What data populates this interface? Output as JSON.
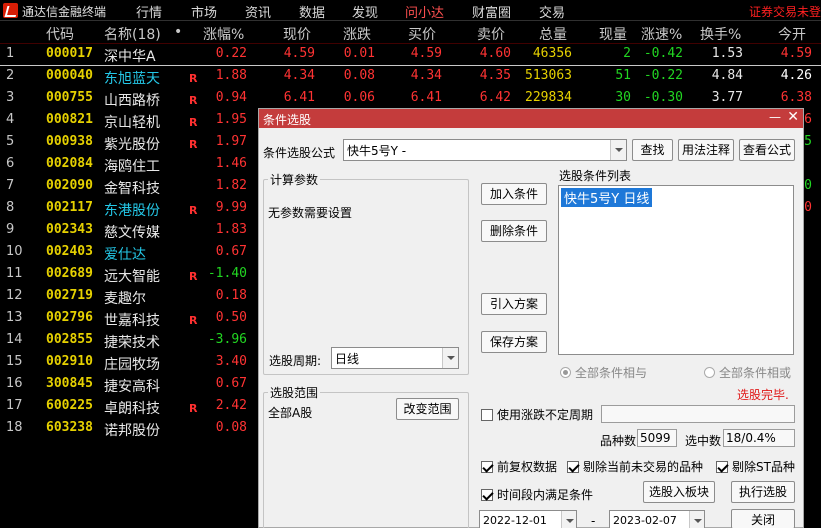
{
  "app": {
    "title": "通达信金融终端",
    "menu": [
      "行情",
      "市场",
      "资讯",
      "数据",
      "发现",
      "问小达",
      "财富圈",
      "交易"
    ],
    "active_menu": 5,
    "trade_notice": "证券交易未登"
  },
  "table": {
    "headers": {
      "code": "代码",
      "name": "名称(18)",
      "dot": "•",
      "pct": "涨幅%",
      "price": "现价",
      "chg": "涨跌",
      "bid": "买价",
      "ask": "卖价",
      "vol": "总量",
      "cur": "现量",
      "speed": "涨速%",
      "turn": "换手%",
      "open": "今开"
    },
    "rows": [
      {
        "idx": "1",
        "code": "000017",
        "name": "深中华A",
        "name_color": "white",
        "r": "",
        "pct": "0.22",
        "price": "4.59",
        "chg": "0.01",
        "bid": "4.59",
        "ask": "4.60",
        "vol": "46356",
        "cur": "2",
        "speed": "-0.42",
        "turn": "1.53",
        "open": "4.59",
        "open_color": "red"
      },
      {
        "idx": "2",
        "code": "000040",
        "name": "东旭蓝天",
        "name_color": "cyan",
        "r": "R",
        "pct": "1.88",
        "price": "4.34",
        "chg": "0.08",
        "bid": "4.34",
        "ask": "4.35",
        "vol": "513063",
        "cur": "51",
        "speed": "-0.22",
        "turn": "4.84",
        "open": "4.26",
        "open_color": "white"
      },
      {
        "idx": "3",
        "code": "000755",
        "name": "山西路桥",
        "name_color": "white",
        "r": "R",
        "pct": "0.94",
        "price": "6.41",
        "chg": "0.06",
        "bid": "6.41",
        "ask": "6.42",
        "vol": "229834",
        "cur": "30",
        "speed": "-0.30",
        "turn": "3.77",
        "open": "6.38",
        "open_color": "red"
      },
      {
        "idx": "4",
        "code": "000821",
        "name": "京山轻机",
        "name_color": "white",
        "r": "R",
        "pct": "1.95",
        "price": "",
        "chg": "",
        "bid": "",
        "ask": "",
        "vol": "",
        "cur": "",
        "speed": "",
        "turn": "",
        "open": "6",
        "open_color": "red"
      },
      {
        "idx": "5",
        "code": "000938",
        "name": "紫光股份",
        "name_color": "white",
        "r": "R",
        "pct": "1.97",
        "price": "",
        "chg": "",
        "bid": "",
        "ask": "",
        "vol": "",
        "cur": "",
        "speed": "",
        "turn": "",
        "open": "5",
        "open_color": "green"
      },
      {
        "idx": "6",
        "code": "002084",
        "name": "海鸥住工",
        "name_color": "white",
        "r": "",
        "pct": "1.46",
        "price": "",
        "chg": "",
        "bid": "",
        "ask": "",
        "vol": "",
        "cur": "",
        "speed": "",
        "turn": "",
        "open": "",
        "open_color": "red"
      },
      {
        "idx": "7",
        "code": "002090",
        "name": "金智科技",
        "name_color": "white",
        "r": "",
        "pct": "1.82",
        "price": "",
        "chg": "",
        "bid": "",
        "ask": "",
        "vol": "",
        "cur": "",
        "speed": "",
        "turn": "",
        "open": "0",
        "open_color": "green"
      },
      {
        "idx": "8",
        "code": "002117",
        "name": "东港股份",
        "name_color": "cyan",
        "r": "R",
        "pct": "9.99",
        "price": "",
        "chg": "",
        "bid": "",
        "ask": "",
        "vol": "",
        "cur": "",
        "speed": "",
        "turn": "",
        "open": "0",
        "open_color": "red"
      },
      {
        "idx": "9",
        "code": "002343",
        "name": "慈文传媒",
        "name_color": "white",
        "r": "",
        "pct": "1.83",
        "price": "",
        "chg": "",
        "bid": "",
        "ask": "",
        "vol": "",
        "cur": "",
        "speed": "",
        "turn": "",
        "open": "",
        "open_color": "red"
      },
      {
        "idx": "10",
        "code": "002403",
        "name": "爱仕达",
        "name_color": "cyan",
        "r": "",
        "pct": "0.67",
        "price": "",
        "chg": "",
        "bid": "",
        "ask": "",
        "vol": "",
        "cur": "",
        "speed": "",
        "turn": "",
        "open": "",
        "open_color": "red"
      },
      {
        "idx": "11",
        "code": "002689",
        "name": "远大智能",
        "name_color": "white",
        "r": "R",
        "pct": "-1.40",
        "price": "",
        "chg": "",
        "bid": "",
        "ask": "",
        "vol": "",
        "cur": "",
        "speed": "",
        "turn": "",
        "open": "",
        "open_color": "red"
      },
      {
        "idx": "12",
        "code": "002719",
        "name": "麦趣尔",
        "name_color": "white",
        "r": "",
        "pct": "0.18",
        "price": "",
        "chg": "",
        "bid": "",
        "ask": "",
        "vol": "",
        "cur": "",
        "speed": "",
        "turn": "",
        "open": "",
        "open_color": "red"
      },
      {
        "idx": "13",
        "code": "002796",
        "name": "世嘉科技",
        "name_color": "white",
        "r": "R",
        "pct": "0.50",
        "price": "",
        "chg": "",
        "bid": "",
        "ask": "",
        "vol": "",
        "cur": "",
        "speed": "",
        "turn": "",
        "open": "",
        "open_color": "red"
      },
      {
        "idx": "14",
        "code": "002855",
        "name": "捷荣技术",
        "name_color": "white",
        "r": "",
        "pct": "-3.96",
        "price": "",
        "chg": "",
        "bid": "",
        "ask": "",
        "vol": "",
        "cur": "",
        "speed": "",
        "turn": "",
        "open": "",
        "open_color": "red"
      },
      {
        "idx": "15",
        "code": "002910",
        "name": "庄园牧场",
        "name_color": "white",
        "r": "",
        "pct": "3.40",
        "price": "",
        "chg": "",
        "bid": "",
        "ask": "",
        "vol": "",
        "cur": "",
        "speed": "",
        "turn": "",
        "open": "",
        "open_color": "red"
      },
      {
        "idx": "16",
        "code": "300845",
        "name": "捷安高科",
        "name_color": "white",
        "r": "",
        "pct": "0.67",
        "price": "",
        "chg": "",
        "bid": "",
        "ask": "",
        "vol": "",
        "cur": "",
        "speed": "",
        "turn": "",
        "open": "",
        "open_color": "red"
      },
      {
        "idx": "17",
        "code": "600225",
        "name": "卓朗科技",
        "name_color": "white",
        "r": "R",
        "pct": "2.42",
        "price": "",
        "chg": "",
        "bid": "",
        "ask": "",
        "vol": "",
        "cur": "",
        "speed": "",
        "turn": "",
        "open": "",
        "open_color": "red"
      },
      {
        "idx": "18",
        "code": "603238",
        "name": "诺邦股份",
        "name_color": "white",
        "r": "",
        "pct": "0.08",
        "price": "",
        "chg": "",
        "bid": "",
        "ask": "",
        "vol": "",
        "cur": "",
        "speed": "",
        "turn": "",
        "open": "",
        "open_color": "red"
      }
    ]
  },
  "dialog": {
    "title": "条件选股",
    "min_glyph": "—",
    "close_glyph": "✕",
    "formula_label": "条件选股公式",
    "formula_value": "快牛5号Y    -",
    "find_btn": "查找",
    "usage_btn": "用法注释",
    "view_formula_btn": "查看公式",
    "params_group": "计算参数",
    "params_text": "无参数需要设置",
    "add_cond_btn": "加入条件",
    "del_cond_btn": "删除条件",
    "import_btn": "引入方案",
    "save_btn": "保存方案",
    "cond_list_label": "选股条件列表",
    "cond_item": "快牛5号Y  日线",
    "period_label": "选股周期:",
    "period_value": "日线",
    "radio_and": "全部条件相与",
    "radio_or": "全部条件相或",
    "status_done": "选股完毕.",
    "range_group": "选股范围",
    "range_value": "全部A股",
    "change_range_btn": "改变范围",
    "uncertain_period": "使用涨跌不定周期",
    "total_label": "品种数",
    "total_value": "5099",
    "hit_label": "选中数",
    "hit_value": "18/0.4%",
    "chk_fq": "前复权数据",
    "chk_exclude_untraded": "剔除当前未交易的品种",
    "chk_exclude_st": "剔除ST品种",
    "chk_time_range": "时间段内满足条件",
    "add_to_block_btn": "选股入板块",
    "run_btn": "执行选股",
    "date_from": "2022-12-01",
    "date_sep": "-",
    "date_to": "2023-02-07",
    "close_btn": "关闭"
  }
}
